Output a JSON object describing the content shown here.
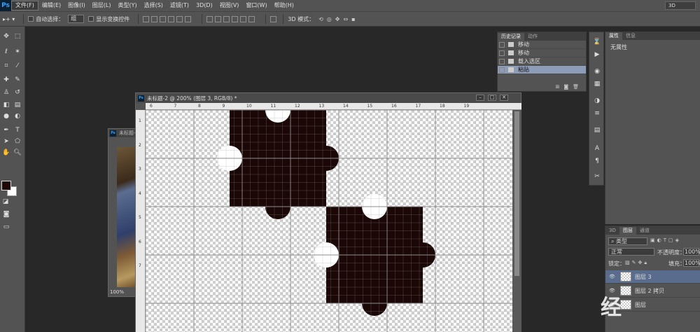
{
  "menubar": {
    "logo": "Ps",
    "items": [
      "文件(F)",
      "编辑(E)",
      "图像(I)",
      "图层(L)",
      "类型(Y)",
      "选择(S)",
      "滤镜(T)",
      "3D(D)",
      "视图(V)",
      "窗口(W)",
      "帮助(H)"
    ],
    "workspace": "3D"
  },
  "options": {
    "auto_select_label": "自动选择：",
    "auto_select_value": "组",
    "show_transform_label": "显示变换控件",
    "mode_3d_label": "3D 模式："
  },
  "tools": [
    "移动",
    "矩形选框",
    "套索",
    "魔棒",
    "裁剪",
    "吸管",
    "修复画笔",
    "画笔",
    "仿制图章",
    "历史记录画笔",
    "橡皮擦",
    "渐变",
    "模糊",
    "减淡",
    "钢笔",
    "文字",
    "路径选择",
    "形状",
    "抓手",
    "缩放"
  ],
  "colors": {
    "foreground": "#1e0807",
    "background": "#ffffff",
    "puzzle": "#1c0707"
  },
  "doc2": {
    "title": "未标题-",
    "zoom": "100%"
  },
  "doc1": {
    "title": "未标题-2 @ 200% (图层 3, RGB/8) *",
    "ruler_h": [
      "6",
      "7",
      "8",
      "9",
      "10",
      "11",
      "12",
      "13",
      "14",
      "15",
      "16",
      "17",
      "18",
      "19"
    ],
    "ruler_v": [
      "1",
      "2",
      "3",
      "4",
      "5",
      "6",
      "7"
    ]
  },
  "history": {
    "tabs": [
      "历史记录",
      "动作"
    ],
    "items": [
      "移动",
      "移动",
      "载入选区",
      "粘贴"
    ],
    "active_index": 3
  },
  "props": {
    "tabs": [
      "属性",
      "信息"
    ],
    "content": "无属性"
  },
  "layers": {
    "tabs": [
      "3D",
      "图层",
      "通道"
    ],
    "filter": "类型",
    "blend_mode": "正常",
    "opacity_label": "不透明度：",
    "opacity": "100%",
    "lock_label": "锁定：",
    "fill_label": "填充：",
    "fill": "100%",
    "items": [
      "图层 3",
      "图层 2 拷贝",
      "图层"
    ],
    "active_index": 0
  },
  "watermark": "经"
}
